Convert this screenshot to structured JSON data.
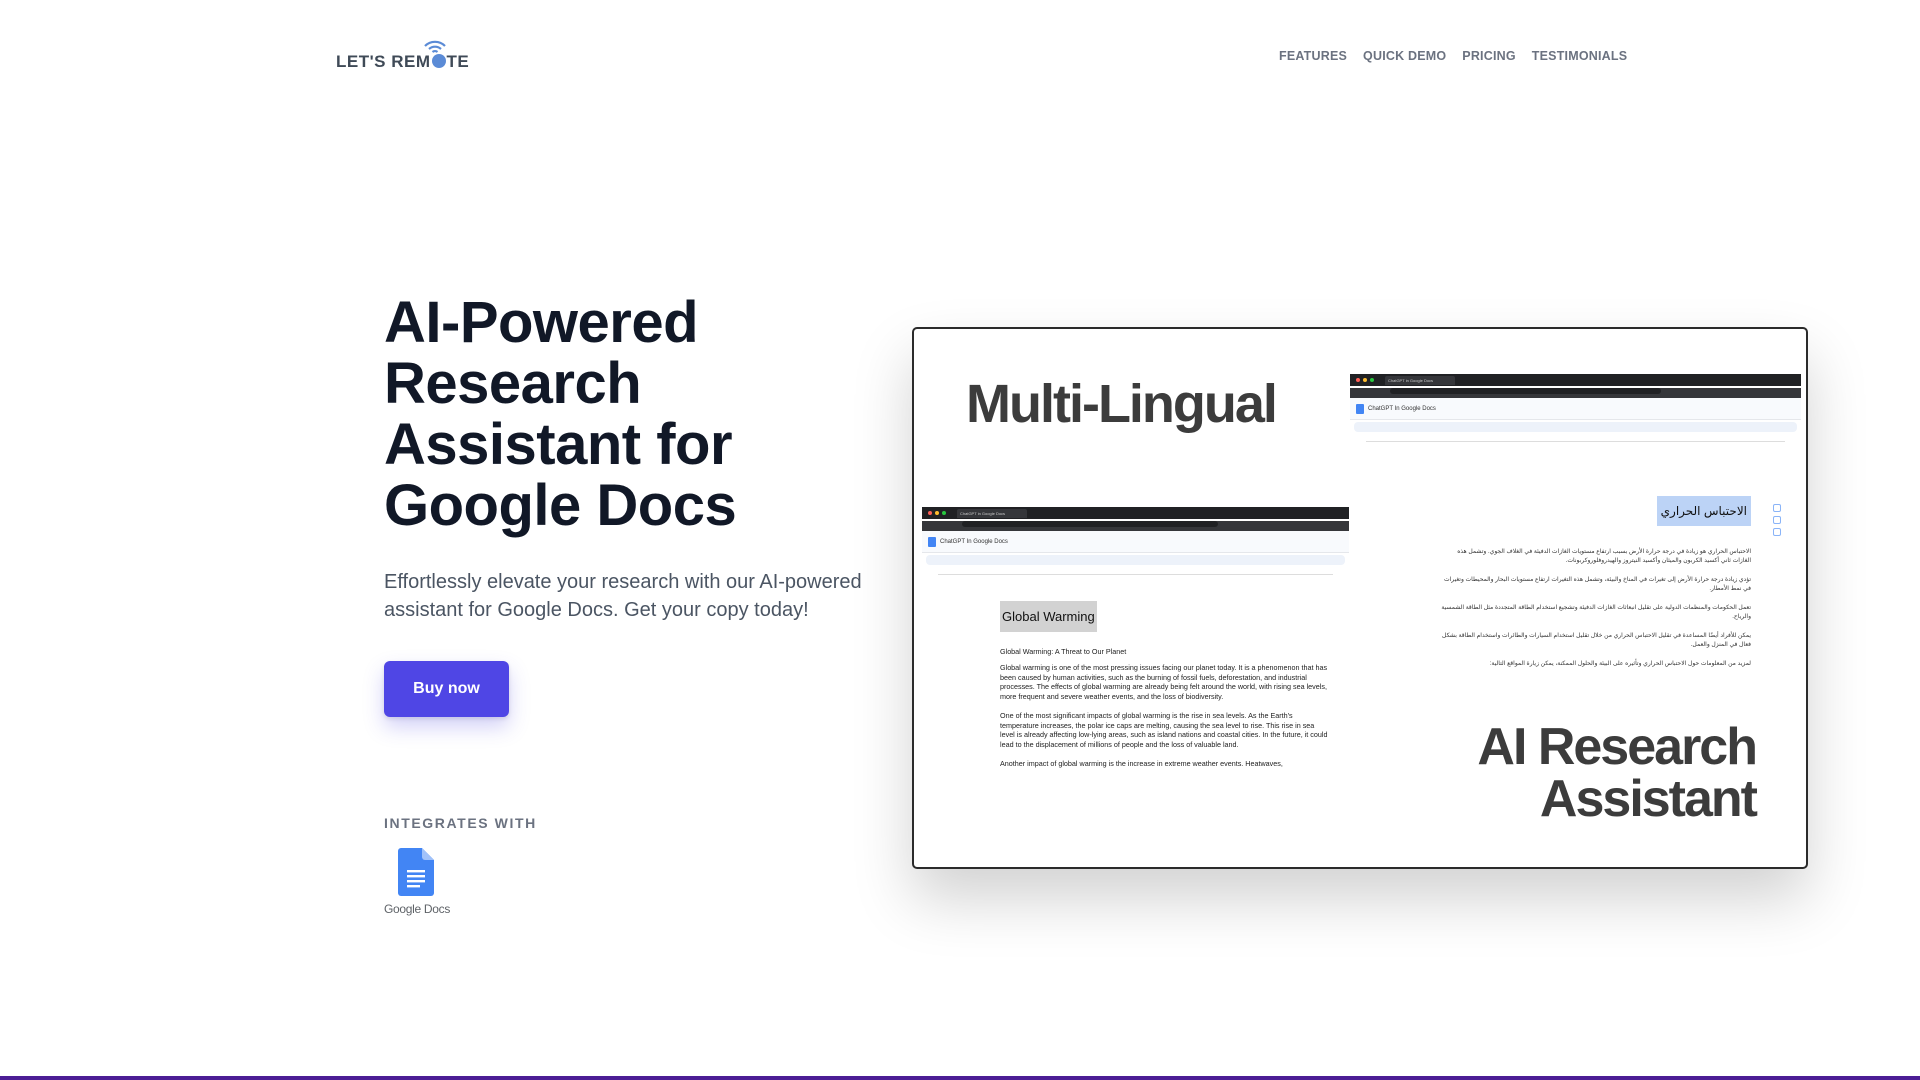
{
  "header": {
    "logo_text_before": "LET'S REM",
    "logo_text_after": "TE",
    "nav": [
      "FEATURES",
      "QUICK DEMO",
      "PRICING",
      "TESTIMONIALS"
    ]
  },
  "hero": {
    "title": "AI-Powered Research Assistant for Google Docs",
    "subtitle": "Effortlessly elevate your research with our AI-powered assistant for Google Docs. Get your copy today!",
    "buy_label": "Buy now",
    "integrates_label": "INTEGRATES WITH",
    "integration_name": "Google Docs",
    "button_color": "#4f46e5"
  },
  "showcase": {
    "multilingual_label": "Multi-Lingual",
    "ai_label_line1": "AI Research",
    "ai_label_line2": "Assistant",
    "left_doc": {
      "tab_title": "ChatGPT in Google Docs",
      "doc_title": "ChatGPT In Google Docs",
      "heading": "Global Warming",
      "subheading": "Global Warming: A Threat to Our Planet",
      "paragraphs": [
        "Global warming is one of the most pressing issues facing our planet today. It is a phenomenon that has been caused by human activities, such as the burning of fossil fuels, deforestation, and industrial processes. The effects of global warming are already being felt around the world, with rising sea levels, more frequent and severe weather events, and the loss of biodiversity.",
        "One of the most significant impacts of global warming is the rise in sea levels. As the Earth's temperature increases, the polar ice caps are melting, causing the sea level to rise. This rise in sea level is already affecting low-lying areas, such as island nations and coastal cities. In the future, it could lead to the displacement of millions of people and the loss of valuable land.",
        "Another impact of global warming is the increase in extreme weather events. Heatwaves,"
      ]
    },
    "right_doc": {
      "tab_title": "ChatGPT in Google Docs",
      "doc_title": "ChatGPT In Google Docs",
      "heading": "الاحتباس الحراري",
      "paragraphs": [
        "الاحتباس الحراري هو زيادة في درجة حرارة الأرض بسبب ارتفاع مستويات الغازات الدفيئة في الغلاف الجوي. وتشمل هذه الغازات ثاني أكسيد الكربون والميثان وأكسيد النيتروز والهيدروفلوروكربونات.",
        "تؤدي زيادة درجة حرارة الأرض إلى تغيرات في المناخ والبيئة، وتشمل هذه التغيرات ارتفاع مستويات البحار والمحيطات وتغيرات في نمط الأمطار.",
        "تعمل الحكومات والمنظمات الدولية على تقليل انبعاثات الغازات الدفيئة وتشجيع استخدام الطاقة المتجددة مثل الطاقة الشمسية والرياح.",
        "يمكن للأفراد أيضًا المساعدة في تقليل الاحتباس الحراري من خلال تقليل استخدام السيارات والطائرات واستخدام الطاقة بشكل فعال في المنزل والعمل.",
        "لمزيد من المعلومات حول الاحتباس الحراري وتأثيره على البيئة والحلول الممكنة، يمكن زيارة المواقع التالية:"
      ]
    }
  }
}
